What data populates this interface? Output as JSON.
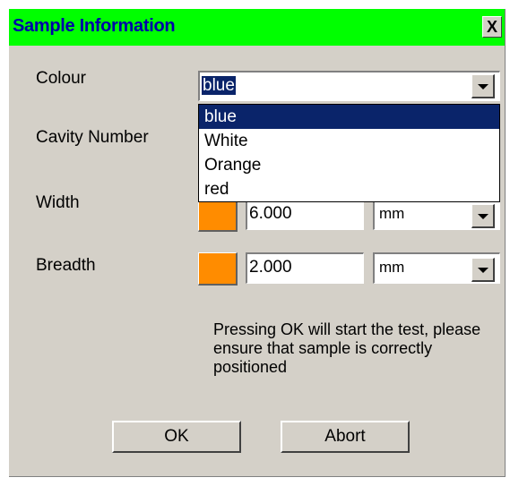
{
  "dialog": {
    "title": "Sample Information",
    "close_label": "X"
  },
  "labels": {
    "colour": "Colour",
    "cavity_number": "Cavity Number",
    "width": "Width",
    "breadth": "Breadth"
  },
  "colour": {
    "value": "blue",
    "options": [
      "blue",
      "White",
      "Orange",
      "red"
    ],
    "selected_index": 0
  },
  "width": {
    "value": "6.000",
    "unit": "mm"
  },
  "breadth": {
    "value": "2.000",
    "unit": "mm"
  },
  "swatch_color": "#ff8c00",
  "title_bar_color": "#00ff00",
  "message": "Pressing OK will start the test, please ensure that sample is correctly positioned",
  "buttons": {
    "ok": "OK",
    "abort": "Abort"
  }
}
